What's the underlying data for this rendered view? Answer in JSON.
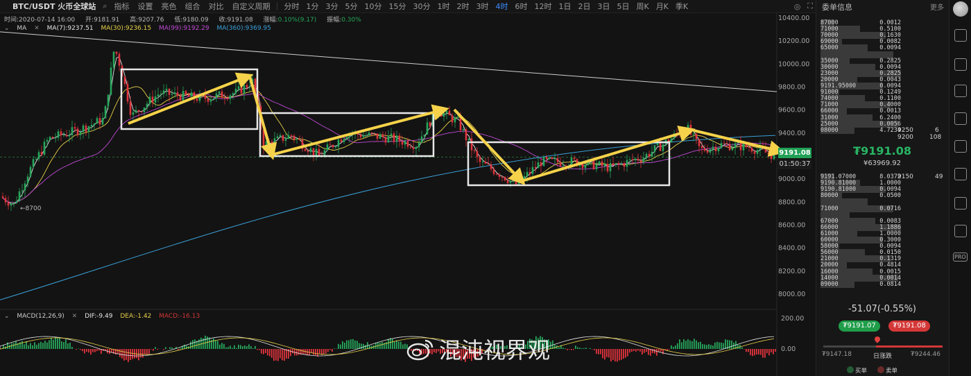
{
  "toolbar": {
    "symbol": "BTC/USDT 火币全球站",
    "indicators": "指标",
    "settings": "设置",
    "theme": "亮色",
    "layout": "组合",
    "compare": "对比",
    "custom_period": "自定义周期",
    "intervals": [
      "分时",
      "1分",
      "3分",
      "5分",
      "10分",
      "15分",
      "30分",
      "1时",
      "2时",
      "3时",
      "4时",
      "6时",
      "12时",
      "1日",
      "2日",
      "3日",
      "5日",
      "周K",
      "月K",
      "季K"
    ],
    "active_interval": "4时"
  },
  "ohlc": {
    "time_label": "时间:",
    "time": "2020-07-14 16:00",
    "open_label": "开:",
    "open": "9181.91",
    "high_label": "高:",
    "high": "9207.76",
    "low_label": "低:",
    "low": "9180.09",
    "close_label": "收:",
    "close": "9191.08",
    "change_label": "涨幅:",
    "change": "0.10%(9.17)",
    "amp_label": "振幅:",
    "amp": "0.30%"
  },
  "ma": {
    "name": "MA",
    "ma7": "MA(7):9237.51",
    "ma30": "MA(30):9236.15",
    "ma99": "MA(99):9192.29",
    "ma360": "MA(360):9369.95",
    "colors": {
      "ma7": "#e6e6e6",
      "ma30": "#e8d14a",
      "ma99": "#c04ad6",
      "ma360": "#3aa0d8"
    }
  },
  "macd": {
    "name": "MACD(12,26,9)",
    "dif": "DIF:-9.49",
    "dea": "DEA:-1.42",
    "macd": "MACD:-16.13"
  },
  "price_axis": [
    "10400.00",
    "10200.00",
    "10000.00",
    "9800.00",
    "9600.00",
    "9400.00",
    "9200.00",
    "9000.00",
    "8800.00",
    "8600.00",
    "8400.00",
    "8200.00",
    "8000.00"
  ],
  "macd_axis": [
    "200.00",
    "0.00"
  ],
  "last_price_tag": "9191.08",
  "countdown_tag": "01:50:37",
  "low_note": "←8700",
  "watermark": "混沌视界观",
  "orderbook": {
    "title": "委单信息",
    "more": "更多",
    "asks": [
      {
        "p": "87000",
        "a": "0.0012"
      },
      {
        "p": "71000",
        "a": "0.5100"
      },
      {
        "p": "70000",
        "a": "0.1630"
      },
      {
        "p": "69000",
        "a": "0.0082"
      },
      {
        "p": "65000",
        "a": "0.0094"
      },
      {
        "p": "",
        "a": ""
      },
      {
        "p": "35000",
        "a": "0.2825"
      },
      {
        "p": "30000",
        "a": "0.0094"
      },
      {
        "p": "23000",
        "a": "0.2825"
      },
      {
        "p": "20000",
        "a": "0.0043"
      },
      {
        "p": "9191.95000",
        "a": "0.0094"
      },
      {
        "p": "91000",
        "a": "0.1249"
      },
      {
        "p": "74000",
        "a": "0.1100"
      },
      {
        "p": "71000",
        "a": "0.4000"
      },
      {
        "p": "66000",
        "a": "0.0013"
      },
      {
        "p": "31000",
        "a": "6.2400"
      },
      {
        "p": "25000",
        "a": "0.0056"
      },
      {
        "p": "08000",
        "a": "4.7234"
      }
    ],
    "mid_price": "₮9191.08",
    "mid_cny": "¥63969.92",
    "bids": [
      {
        "p": "9191.07000",
        "a": "8.0372"
      },
      {
        "p": "9190.81000",
        "a": "1.0000"
      },
      {
        "p": "9190.81000",
        "a": "0.0094"
      },
      {
        "p": "80000",
        "a": "0.0500"
      },
      {
        "p": "",
        "a": ""
      },
      {
        "p": "71000",
        "a": "0.0716"
      },
      {
        "p": "",
        "a": ""
      },
      {
        "p": "67000",
        "a": "0.0083"
      },
      {
        "p": "66000",
        "a": "1.1886"
      },
      {
        "p": "61000",
        "a": "1.0000"
      },
      {
        "p": "60000",
        "a": "0.3000"
      },
      {
        "p": "58000",
        "a": "0.0094"
      },
      {
        "p": "56000",
        "a": "0.0150"
      },
      {
        "p": "21000",
        "a": "0.1319"
      },
      {
        "p": "20000",
        "a": "0.4814"
      },
      {
        "p": "16000",
        "a": "0.0015"
      },
      {
        "p": "14000",
        "a": "0.0014"
      },
      {
        "p": "09000",
        "a": "0.0814"
      }
    ],
    "agg": [
      {
        "price": "9250",
        "count": "6"
      },
      {
        "price": "9200",
        "count": "108"
      },
      {
        "price": "9150",
        "count": "49"
      }
    ],
    "change": "-51.07(-0.55%)",
    "buy_btn": "₮9191.07",
    "sell_btn": "₮9191.08",
    "range_lo": "₮9147.18",
    "range_mid": "日涨跌",
    "range_hi": "₮9244.46",
    "legend_buy": "买单",
    "legend_sell": "卖单"
  },
  "colors": {
    "up": "#26a65b",
    "down": "#e0343c",
    "arrow": "#f5d24a",
    "box": "#e8e8e8",
    "accent": "#3c8cff"
  }
}
